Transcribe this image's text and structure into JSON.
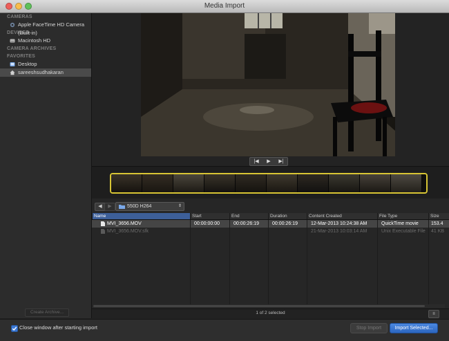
{
  "window": {
    "title": "Media Import"
  },
  "sidebar": {
    "sections": [
      {
        "heading": "CAMERAS",
        "items": [
          {
            "label": "Apple FaceTime HD Camera (Built-in)",
            "icon": "camera-icon"
          }
        ]
      },
      {
        "heading": "DEVICES",
        "items": [
          {
            "label": "Macintosh HD",
            "icon": "hard-drive-icon"
          }
        ]
      },
      {
        "heading": "CAMERA ARCHIVES",
        "items": []
      },
      {
        "heading": "FAVORITES",
        "items": [
          {
            "label": "Desktop",
            "icon": "desktop-folder-icon"
          },
          {
            "label": "sareeshsudhakaran",
            "icon": "home-icon",
            "selected": true
          }
        ]
      }
    ],
    "create_archive_label": "Create Archive..."
  },
  "viewer": {
    "transport": {
      "prev": "|◀",
      "play": "▶",
      "next": "▶|"
    }
  },
  "browser": {
    "folder": "550D H264",
    "columns": [
      "Name",
      "Start",
      "End",
      "Duration",
      "Content Created",
      "File Type",
      "Size"
    ],
    "rows": [
      {
        "name": "MVI_3656.MOV",
        "start": "00:00:00:00",
        "end": "00:00:26:19",
        "duration": "00:00:26:19",
        "created": "12-Mar-2013 10:24:38 AM",
        "type": "QuickTime movie",
        "size": "153.4"
      },
      {
        "name": "MVI_3656.MOV.sfk",
        "start": "",
        "end": "",
        "duration": "",
        "created": "21-Mar-2013 10:03:14 AM",
        "type": "Unix Executable File",
        "size": "41 KB"
      }
    ],
    "status": "1 of 2 selected"
  },
  "footer": {
    "close_window_label": "Close window after starting import",
    "stop_import_label": "Stop Import",
    "import_selected_label": "Import Selected..."
  },
  "colors": {
    "accent": "#3d5f99",
    "filmstrip_border": "#d8c534",
    "primary_button": "#2c66c0"
  }
}
